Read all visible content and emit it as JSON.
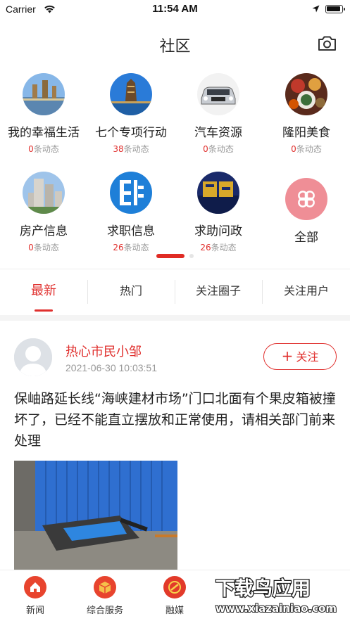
{
  "status_bar": {
    "carrier": "Carrier",
    "time": "11:54 AM"
  },
  "nav": {
    "title": "社区",
    "camera_icon": "camera-icon"
  },
  "circles": [
    {
      "name": "我的幸福生活",
      "count": "0",
      "suffix": "条动态"
    },
    {
      "name": "七个专项行动",
      "count": "38",
      "suffix": "条动态"
    },
    {
      "name": "汽车资源",
      "count": "0",
      "suffix": "条动态"
    },
    {
      "name": "隆阳美食",
      "count": "0",
      "suffix": "条动态"
    },
    {
      "name": "房产信息",
      "count": "0",
      "suffix": "条动态"
    },
    {
      "name": "求职信息",
      "count": "26",
      "suffix": "条动态"
    },
    {
      "name": "求助问政",
      "count": "26",
      "suffix": "条动态"
    },
    {
      "name": "全部"
    }
  ],
  "tabs": [
    "最新",
    "热门",
    "关注圈子",
    "关注用户"
  ],
  "post": {
    "user": "热心市民小邹",
    "time": "2021-06-30 10:03:51",
    "follow": "关注",
    "text": "保岫路延长线“海峡建材市场”门口北面有个果皮箱被撞坏了，已经不能直立摆放和正常使用，请相关部门前来处理"
  },
  "tabbar": [
    "新闻",
    "综合服务",
    "融媒"
  ],
  "watermark": "下载鸟应用 www.xiazainiao.com",
  "colors": {
    "accent": "#e0302e"
  }
}
